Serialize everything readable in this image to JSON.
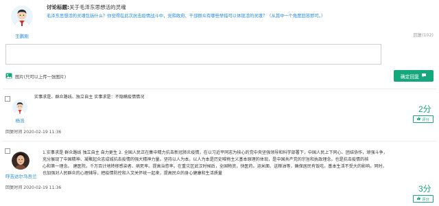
{
  "topic": {
    "title_label": "讨论标题:",
    "title": "关于毛泽东思想活的灵魂",
    "body": "毛泽东思想活的灵魂包括什么？你觉得在此次抗击疫情战斗中，党和政府、干部群众有哪些举措可以体现活的灵魂？（从其中一个角度回答即可。）",
    "author": "王鹏刚",
    "reply_count": "回复(102)"
  },
  "composer": {
    "image_label": "图片(只可以上传一张图片)",
    "submit_label": "确定回复"
  },
  "replies": [
    {
      "user": "杨浩",
      "text": "实事求是、群众路线、独立自主 实事求是：不隐瞒疫情情况",
      "time": "回复时间 2020-02-19 11:36",
      "score": "2分",
      "like_label": "评分"
    },
    {
      "user": "呼吉达尔马吾兰",
      "text_lines": [
        "1.实事求是 群众路线 独立自主 自力更生 2. 全国人民正在集中精力抗击新冠肺炎疫情，在以习近平同志为核心的党中央坚强领导和科学部署下，中国人民上下同心、团结协作，顽强斗争，",
        "充分展现了中国精神、凝聚起众志成城抗击疫情的强大精神力量。坚持以人为本。以人为本是历史唯物主义基本原理的体现，是中国共产党的宗旨和执政理念。也是抗击疫情的核",
        "心和第一理念。 建医院，千万百计地转移感染者、病死率。提高治愈率。在重灾区武汉时候后，全国物资，快医药。运米面、送粮油等，确保居民有饭吃。基本生活不受大的影响。同时，",
        "也加强对人民群众的心理辅导，把疫情防控和人文关怀统一起来，提高民众的身心健康和生活质量"
      ],
      "time": "回复时间 2020-02-19 11:36",
      "score": "3分",
      "like_label": "评分"
    }
  ],
  "colors": {
    "accent": "#17a77c",
    "link": "#1e88e5"
  },
  "icons": {
    "image": "image-icon",
    "chat": "chat-icon",
    "thumb": "thumbs-up-icon"
  }
}
